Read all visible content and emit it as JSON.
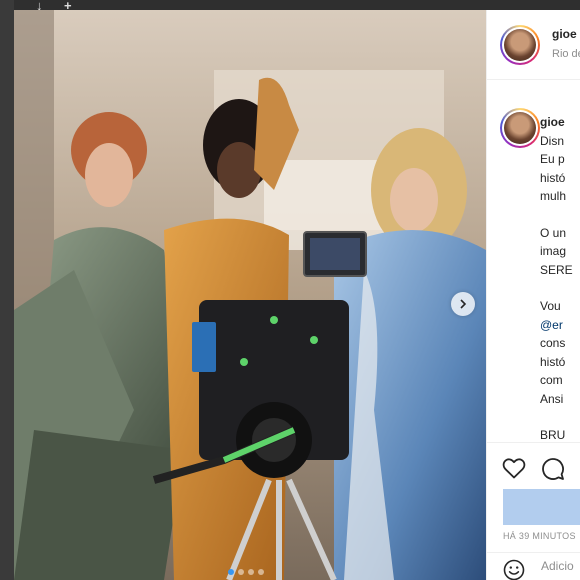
{
  "browser_overlay": {
    "glyph_left": "↓",
    "glyph_right": "+"
  },
  "post": {
    "header": {
      "username": "gioe",
      "location": "Rio de",
      "avatar_icon": "profile-avatar"
    },
    "caption": {
      "username": "gioe",
      "lines": [
        "Disn",
        "Eu p",
        "histó",
        "mulh"
      ],
      "para2": [
        "O un",
        "imag",
        "SERE"
      ],
      "para3_a": "Vou",
      "para3_mention": "@er",
      "para3_b": [
        "cons",
        "histó",
        "com",
        "Ansi"
      ],
      "para4": "BRU"
    },
    "media": {
      "carousel_next_icon": "chevron-right-icon",
      "slides": 4,
      "active_slide": 1
    },
    "actions": {
      "like_icon": "heart-icon",
      "comment_icon": "comment-icon",
      "time": "HÁ 39 MINUTOS"
    },
    "add_comment": {
      "emoji_icon": "smile-icon",
      "placeholder": "Adicio"
    },
    "colors": {
      "link": "#00376b",
      "muted": "#8e8e8e",
      "text": "#262626",
      "accent": "#3897f0",
      "likes_bar": "#b2cdee"
    }
  }
}
